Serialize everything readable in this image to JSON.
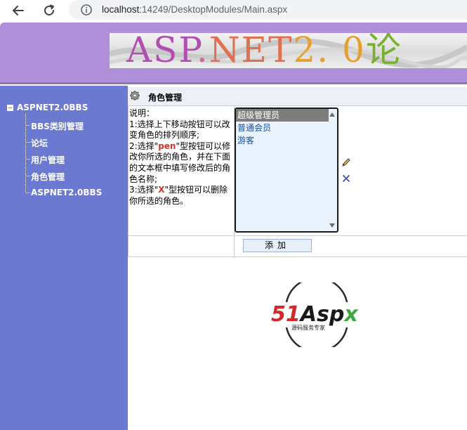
{
  "browser": {
    "url_host": "localhost",
    "url_rest": ":14249/DesktopModules/Main.aspx"
  },
  "banner": {
    "text_parts": [
      "ASP",
      ".",
      "NET",
      "2",
      ". 0",
      "论"
    ]
  },
  "sidebar": {
    "root_label": "ASPNET2.0BBS",
    "items": [
      {
        "label": "BBS类别管理"
      },
      {
        "label": "论坛"
      },
      {
        "label": "用户管理"
      },
      {
        "label": "角色管理"
      },
      {
        "label": "ASPNET2.0BBS"
      }
    ]
  },
  "content": {
    "title": "角色管理",
    "desc": {
      "intro": "说明：",
      "line1": "1:选择上下移动按钮可以改变角色的排列顺序;",
      "line2_pre": "2:选择\"",
      "line2_hl": "pen",
      "line2_post": "\"型按钮可以修改你所选的角色，并在下面的文本框中填写修改后的角色名称;",
      "line3_pre": "3:选择\"",
      "line3_hl": "X",
      "line3_post": "\"型按钮可以删除你所选的角色。"
    },
    "roles": [
      "超级管理员",
      "普通会员",
      "游客"
    ],
    "add_button_label": "添加"
  },
  "logo": {
    "brand": "51Aspx",
    "tagline": "源码服务专家"
  },
  "colors": {
    "header": "#b08fd9",
    "sidebar": "#6b79d1",
    "highlight": "#d2332c"
  }
}
